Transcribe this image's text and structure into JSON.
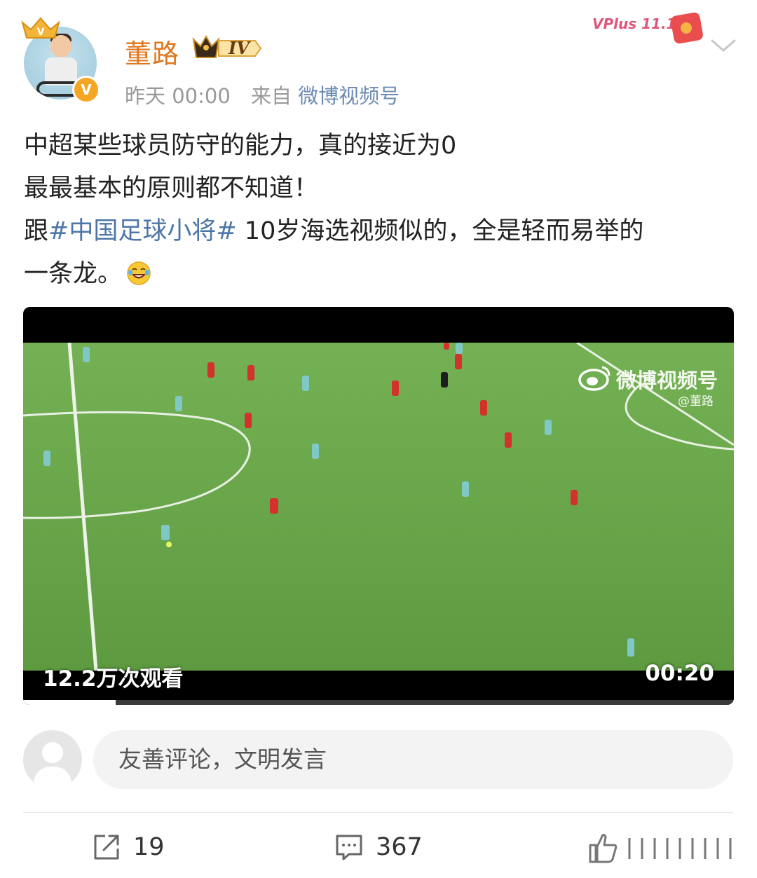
{
  "header": {
    "username": "董路",
    "level": "IV",
    "time": "昨天 00:00",
    "from_label": "来自",
    "source": "微博视频号",
    "promo": "VPlus 11.11"
  },
  "post": {
    "lines": [
      "中超某些球员防守的能力，真的接近为0",
      "最最基本的原则都不知道！"
    ],
    "line3_prefix": "跟",
    "hashtag": "#中国足球小将#",
    "line3_suffix": " 10岁海选视频似的，全是轻而易举的",
    "line4": "一条龙。",
    "emoji": "laugh-cry-emoji"
  },
  "video": {
    "view_count": "12.2万次观看",
    "duration": "00:20",
    "progress": 0.13,
    "watermark_title": "微博视频号",
    "watermark_handle": "@董路"
  },
  "comment_input": {
    "placeholder": "友善评论，文明发言"
  },
  "actions": {
    "repost_count": "19",
    "comment_count": "367"
  },
  "colors": {
    "username": "#e0771e",
    "link": "#4d76a8",
    "field_green": "#6aa84a"
  }
}
